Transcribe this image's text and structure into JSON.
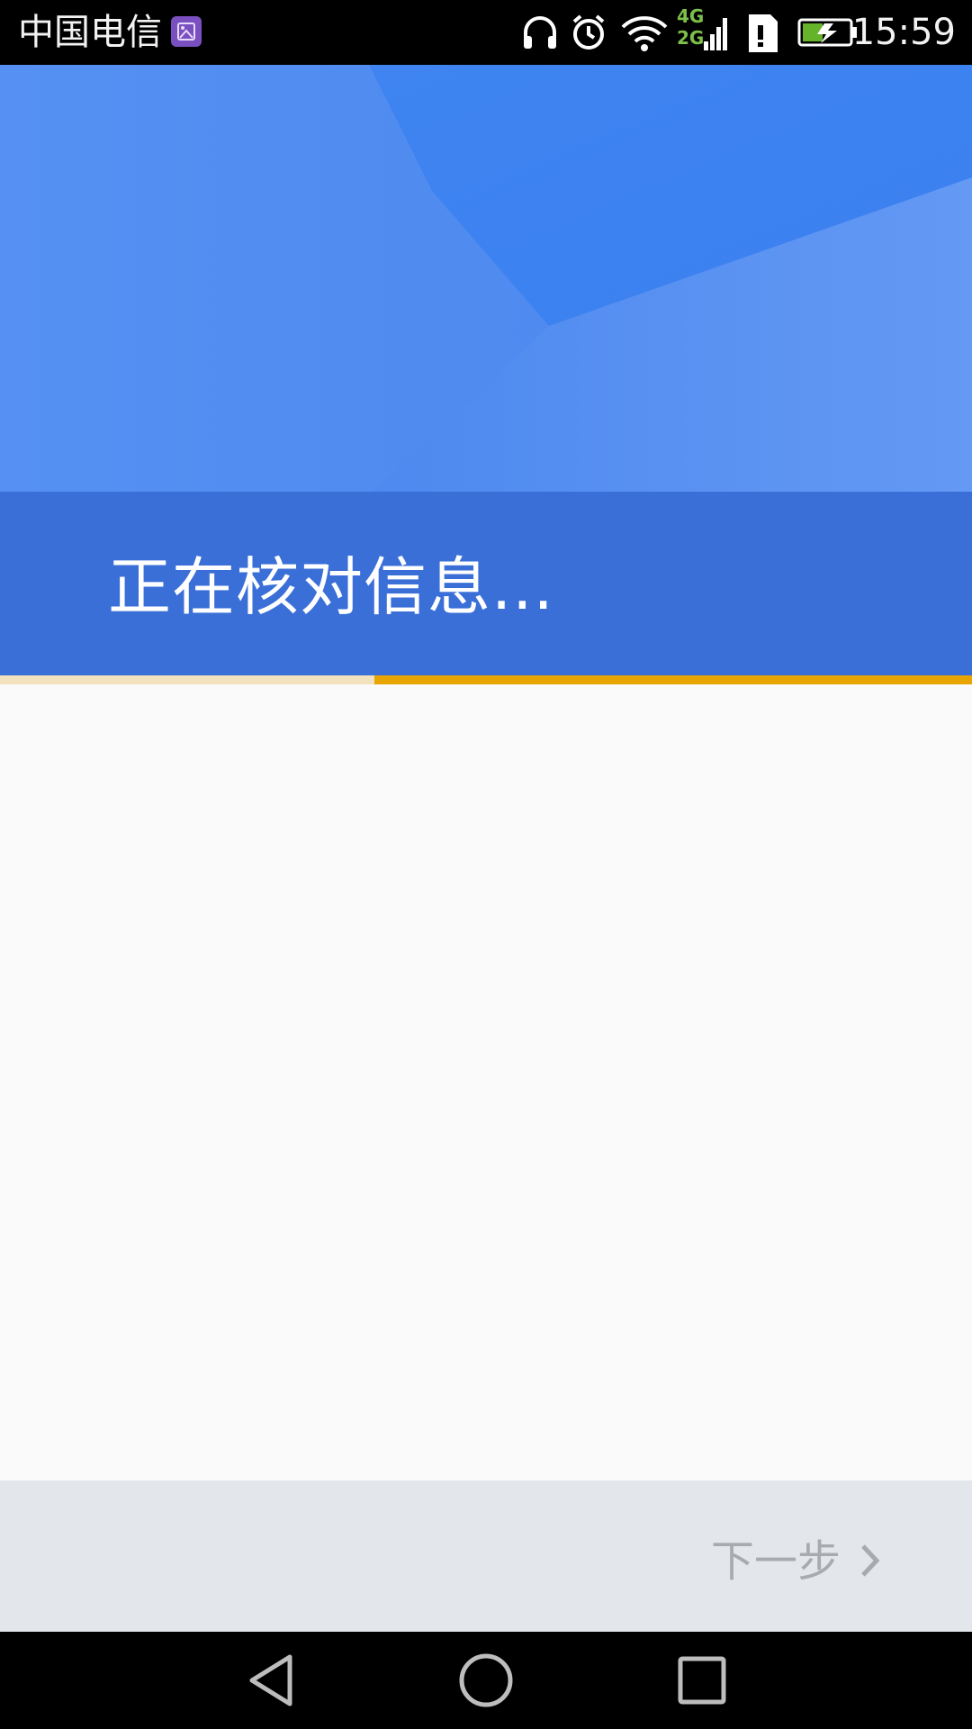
{
  "status_bar": {
    "carrier": "中国电信",
    "network_4g": "4G",
    "network_2g": "2G",
    "time": "15:59",
    "icons": [
      "gallery-notification-icon",
      "headphones-icon",
      "alarm-icon",
      "wifi-icon",
      "cell-signal-icon",
      "sim-card-icon",
      "battery-charging-icon"
    ]
  },
  "header": {
    "title": "正在核对信息..."
  },
  "progress": {
    "value": 0.615
  },
  "footer": {
    "next_label": "下一步"
  },
  "navigation": {
    "icons": [
      "back-icon",
      "home-icon",
      "recents-icon"
    ]
  },
  "colors": {
    "header_blue": "#4f8bf0",
    "title_band": "#3a6fd8",
    "progress_fill": "#e8a400",
    "progress_track": "#f3e2bf",
    "action_bar": "#e3e6ea",
    "next_text": "#a7abb0"
  }
}
